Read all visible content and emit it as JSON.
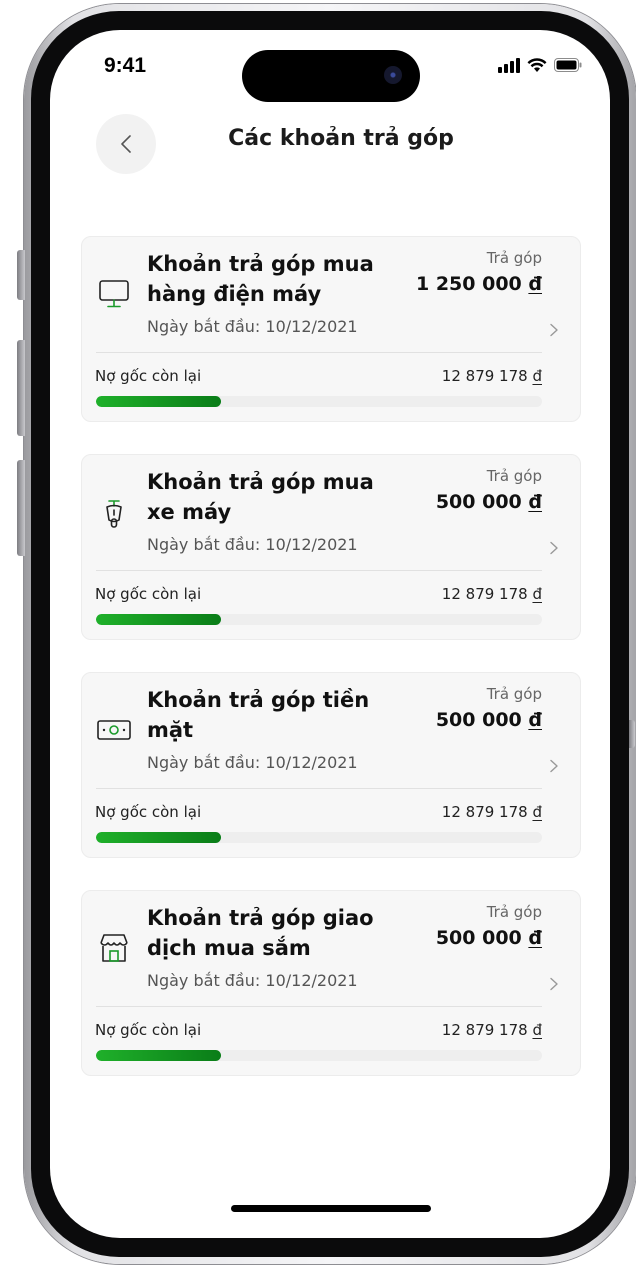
{
  "status": {
    "time": "9:41"
  },
  "header": {
    "title": "Các khoản trả góp"
  },
  "colors": {
    "accent": "#0f8a1e",
    "card_bg": "#f7f7f7"
  },
  "loans": [
    {
      "icon": "monitor-icon",
      "title": "Khoản trả góp mua hàng điện máy",
      "start_date": "Ngày bắt đầu: 10/12/2021",
      "installment_label": "Trả góp",
      "installment_amount": "1 250 000",
      "currency": "đ",
      "balance_label": "Nợ gốc còn lại",
      "balance_amount": "12 879 178",
      "progress_percent": 28
    },
    {
      "icon": "motorbike-icon",
      "title": "Khoản trả góp mua xe máy",
      "start_date": "Ngày bắt đầu: 10/12/2021",
      "installment_label": "Trả góp",
      "installment_amount": "500 000",
      "currency": "đ",
      "balance_label": "Nợ gốc còn lại",
      "balance_amount": "12 879 178",
      "progress_percent": 28
    },
    {
      "icon": "cash-icon",
      "title": "Khoản trả góp tiền mặt",
      "start_date": "Ngày bắt đầu: 10/12/2021",
      "installment_label": "Trả góp",
      "installment_amount": "500 000",
      "currency": "đ",
      "balance_label": "Nợ gốc còn lại",
      "balance_amount": "12 879 178",
      "progress_percent": 28
    },
    {
      "icon": "store-icon",
      "title": "Khoản trả góp giao dịch mua sắm",
      "start_date": "Ngày bắt đầu: 10/12/2021",
      "installment_label": "Trả góp",
      "installment_amount": "500 000",
      "currency": "đ",
      "balance_label": "Nợ gốc còn lại",
      "balance_amount": "12 879 178",
      "progress_percent": 28
    }
  ]
}
